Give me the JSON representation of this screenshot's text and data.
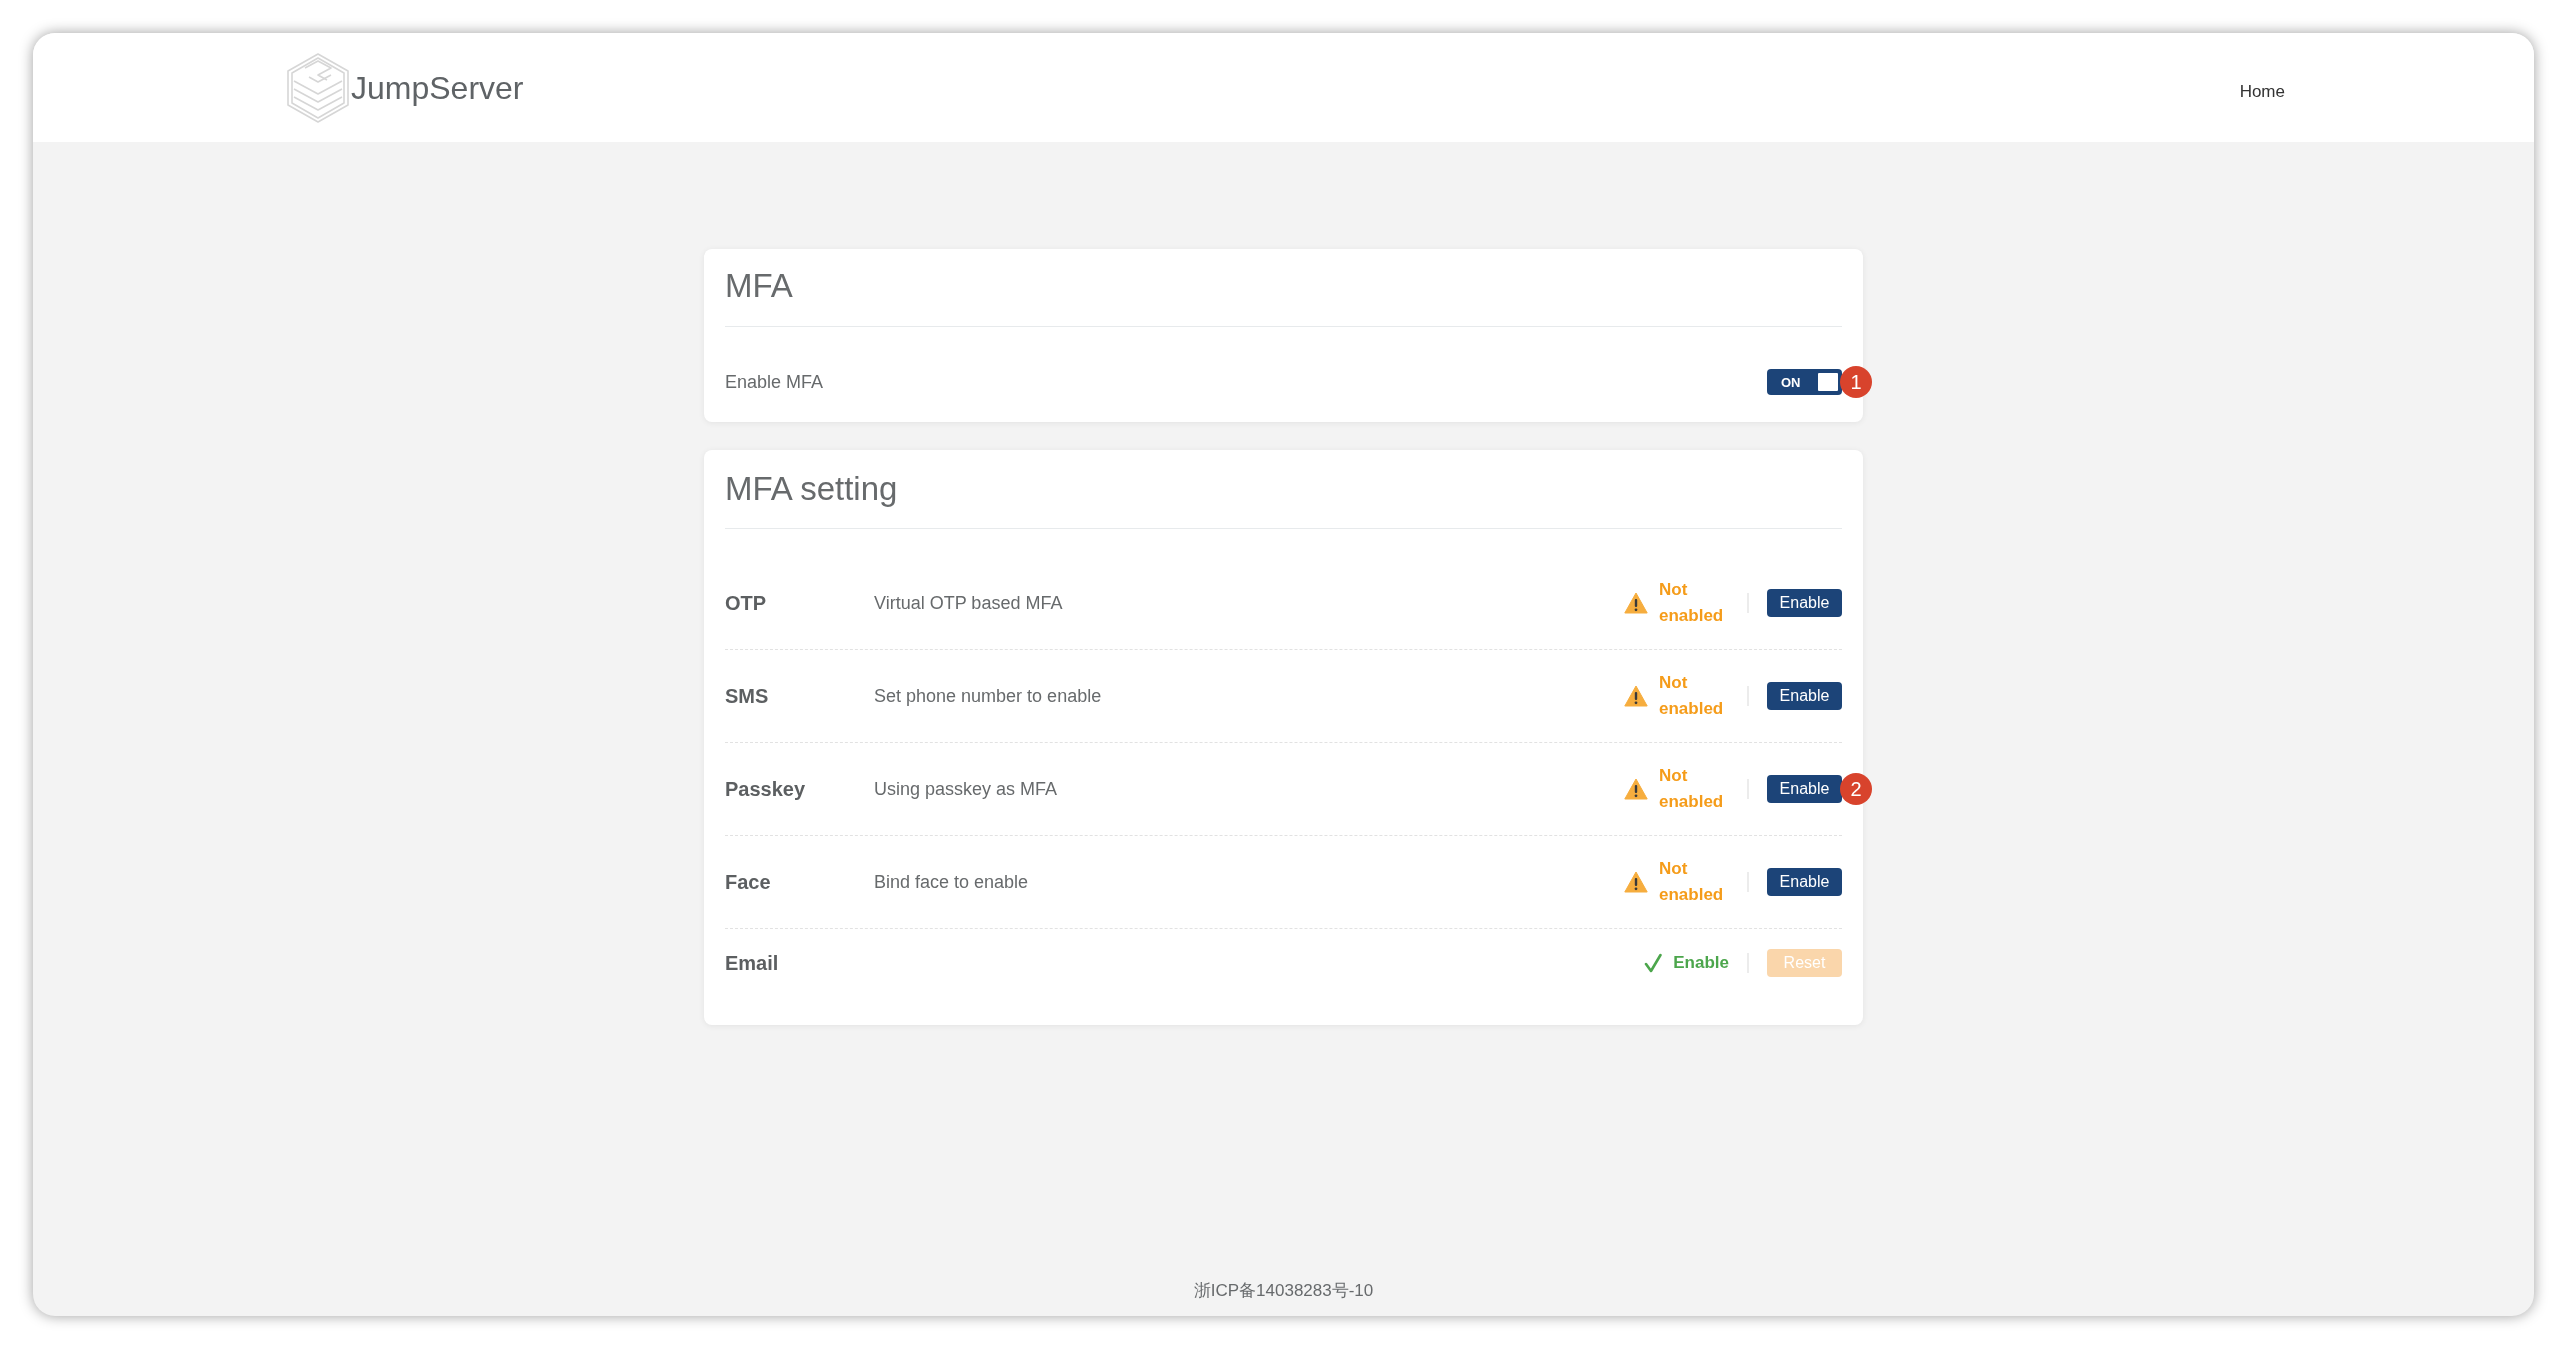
{
  "header": {
    "logo_text": "JumpServer",
    "nav": [
      {
        "label": "Home"
      }
    ]
  },
  "mfa_card": {
    "title": "MFA",
    "label": "Enable MFA",
    "toggle": {
      "label": "ON",
      "on": true
    },
    "annotation": "1"
  },
  "settings_card": {
    "title": "MFA setting",
    "methods": [
      {
        "name": "OTP",
        "description": "Virtual OTP based MFA",
        "status": {
          "kind": "warning",
          "text": "Not enabled"
        },
        "button": {
          "label": "Enable",
          "kind": "primary",
          "disabled": false
        }
      },
      {
        "name": "SMS",
        "description": "Set phone number to enable",
        "status": {
          "kind": "warning",
          "text": "Not enabled"
        },
        "button": {
          "label": "Enable",
          "kind": "primary",
          "disabled": false
        }
      },
      {
        "name": "Passkey",
        "description": "Using passkey as MFA",
        "status": {
          "kind": "warning",
          "text": "Not enabled"
        },
        "button": {
          "label": "Enable",
          "kind": "primary",
          "disabled": false
        },
        "annotation": "2"
      },
      {
        "name": "Face",
        "description": "Bind face to enable",
        "status": {
          "kind": "warning",
          "text": "Not enabled"
        },
        "button": {
          "label": "Enable",
          "kind": "primary",
          "disabled": false
        }
      },
      {
        "name": "Email",
        "status": {
          "kind": "ok",
          "text": "Enable"
        },
        "button": {
          "label": "Reset",
          "kind": "warning",
          "disabled": true
        }
      }
    ]
  },
  "footer": {
    "text": "浙ICP备14038283号-10"
  }
}
